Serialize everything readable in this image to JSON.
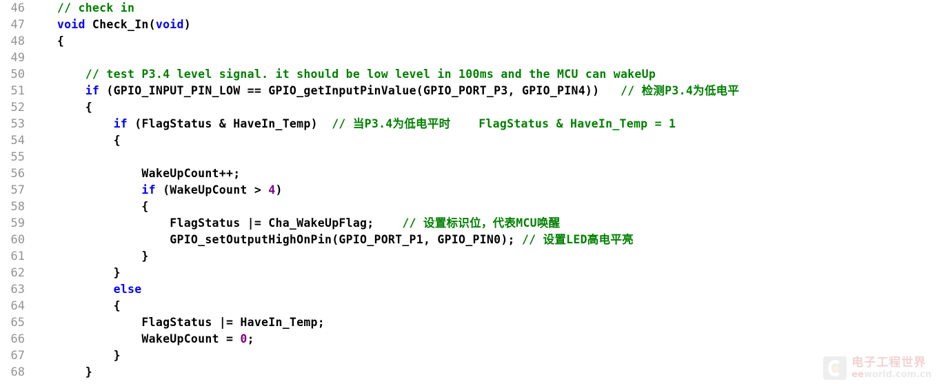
{
  "editor": {
    "background_color": "#ffffff",
    "line_number_color": "#939393",
    "first_line_number": 46,
    "last_line_number": 68,
    "colors": {
      "plain": "#000000",
      "keyword": "#0000ff",
      "comment": "#008000",
      "number": "#800080"
    }
  },
  "lines": [
    {
      "number": "46",
      "tokens": [
        {
          "text": "    ",
          "type": "plain"
        },
        {
          "text": "// check in",
          "type": "comment"
        }
      ]
    },
    {
      "number": "47",
      "tokens": [
        {
          "text": "    ",
          "type": "plain"
        },
        {
          "text": "void",
          "type": "keyword"
        },
        {
          "text": " Check_In(",
          "type": "plain"
        },
        {
          "text": "void",
          "type": "keyword"
        },
        {
          "text": ")",
          "type": "plain"
        }
      ]
    },
    {
      "number": "48",
      "tokens": [
        {
          "text": "    {",
          "type": "plain"
        }
      ]
    },
    {
      "number": "49",
      "tokens": [
        {
          "text": "",
          "type": "plain"
        }
      ]
    },
    {
      "number": "50",
      "tokens": [
        {
          "text": "        ",
          "type": "plain"
        },
        {
          "text": "// test P3.4 level signal. it should be low level in 100ms and the MCU can wakeUp",
          "type": "comment"
        }
      ]
    },
    {
      "number": "51",
      "tokens": [
        {
          "text": "        ",
          "type": "plain"
        },
        {
          "text": "if",
          "type": "keyword"
        },
        {
          "text": " (GPIO_INPUT_PIN_LOW == GPIO_getInputPinValue(GPIO_PORT_P3, GPIO_PIN4))   ",
          "type": "plain"
        },
        {
          "text": "// 检测P3.4为低电平",
          "type": "comment"
        }
      ]
    },
    {
      "number": "52",
      "tokens": [
        {
          "text": "        {",
          "type": "plain"
        }
      ]
    },
    {
      "number": "53",
      "tokens": [
        {
          "text": "            ",
          "type": "plain"
        },
        {
          "text": "if",
          "type": "keyword"
        },
        {
          "text": " (FlagStatus & HaveIn_Temp)  ",
          "type": "plain"
        },
        {
          "text": "// 当P3.4为低电平时    FlagStatus & HaveIn_Temp = 1",
          "type": "comment"
        }
      ]
    },
    {
      "number": "54",
      "tokens": [
        {
          "text": "            {",
          "type": "plain"
        }
      ]
    },
    {
      "number": "55",
      "tokens": [
        {
          "text": "",
          "type": "plain"
        }
      ]
    },
    {
      "number": "56",
      "tokens": [
        {
          "text": "                WakeUpCount++;",
          "type": "plain"
        }
      ]
    },
    {
      "number": "57",
      "tokens": [
        {
          "text": "                ",
          "type": "plain"
        },
        {
          "text": "if",
          "type": "keyword"
        },
        {
          "text": " (WakeUpCount > ",
          "type": "plain"
        },
        {
          "text": "4",
          "type": "number"
        },
        {
          "text": ")",
          "type": "plain"
        }
      ]
    },
    {
      "number": "58",
      "tokens": [
        {
          "text": "                {",
          "type": "plain"
        }
      ]
    },
    {
      "number": "59",
      "tokens": [
        {
          "text": "                    FlagStatus |= Cha_WakeUpFlag;    ",
          "type": "plain"
        },
        {
          "text": "// 设置标识位，代表MCU唤醒",
          "type": "comment"
        }
      ]
    },
    {
      "number": "60",
      "tokens": [
        {
          "text": "                    GPIO_setOutputHighOnPin(GPIO_PORT_P1, GPIO_PIN0); ",
          "type": "plain"
        },
        {
          "text": "// 设置LED高电平亮",
          "type": "comment"
        }
      ]
    },
    {
      "number": "61",
      "tokens": [
        {
          "text": "                }",
          "type": "plain"
        }
      ]
    },
    {
      "number": "62",
      "tokens": [
        {
          "text": "            }",
          "type": "plain"
        }
      ]
    },
    {
      "number": "63",
      "tokens": [
        {
          "text": "            ",
          "type": "plain"
        },
        {
          "text": "else",
          "type": "keyword"
        }
      ]
    },
    {
      "number": "64",
      "tokens": [
        {
          "text": "            {",
          "type": "plain"
        }
      ]
    },
    {
      "number": "65",
      "tokens": [
        {
          "text": "                FlagStatus |= HaveIn_Temp;",
          "type": "plain"
        }
      ]
    },
    {
      "number": "66",
      "tokens": [
        {
          "text": "                WakeUpCount = ",
          "type": "plain"
        },
        {
          "text": "0",
          "type": "number"
        },
        {
          "text": ";",
          "type": "plain"
        }
      ]
    },
    {
      "number": "67",
      "tokens": [
        {
          "text": "            }",
          "type": "plain"
        }
      ]
    },
    {
      "number": "68",
      "tokens": [
        {
          "text": "        }",
          "type": "plain"
        }
      ]
    }
  ],
  "watermark": {
    "cn_text": "电子工程世界",
    "en_prefix": "ee",
    "en_suffix": "world.com.cn",
    "logo_icon": "eeworld-logo-icon"
  }
}
